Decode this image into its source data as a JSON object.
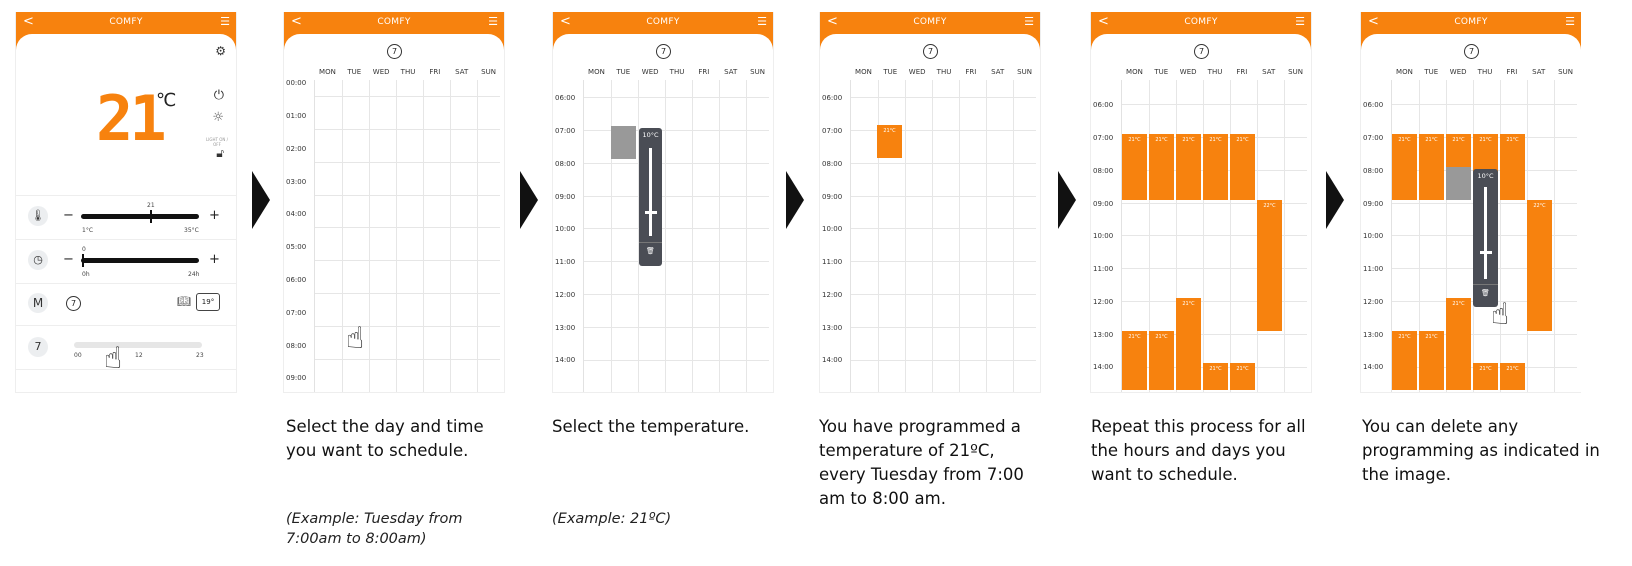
{
  "app": {
    "title": "COMFY",
    "back": "<",
    "menu": "☰",
    "mode_icon": "7"
  },
  "days": [
    "MON",
    "TUE",
    "WED",
    "THU",
    "FRI",
    "SAT",
    "SUN"
  ],
  "panel1": {
    "temperature": "21",
    "unit": "℃",
    "light_label": "LIGHT ON / OFF",
    "temp_slider": {
      "value": "21",
      "level": 0.59,
      "min": "1°C",
      "max": "35°C"
    },
    "timer_slider": {
      "value": "0",
      "level": 0.0,
      "min": "0h",
      "max": "24h"
    },
    "mode_letter": "M",
    "mode_badge": "7",
    "away_badge": "19°",
    "day_scale": {
      "start": "00",
      "mid": "12",
      "end": "23"
    }
  },
  "panel2": {
    "times": [
      "00:00",
      "01:00",
      "02:00",
      "03:00",
      "04:00",
      "05:00",
      "06:00",
      "07:00",
      "08:00",
      "09:00"
    ]
  },
  "panel3": {
    "times": [
      "06:00",
      "07:00",
      "08:00",
      "09:00",
      "10:00",
      "11:00",
      "12:00",
      "13:00",
      "14:00"
    ],
    "popup_value": "10°C"
  },
  "panel4": {
    "times": [
      "06:00",
      "07:00",
      "08:00",
      "09:00",
      "10:00",
      "11:00",
      "12:00",
      "13:00",
      "14:00"
    ],
    "block_label": "21°C"
  },
  "panel5": {
    "times": [
      "06:00",
      "07:00",
      "08:00",
      "09:00",
      "10:00",
      "11:00",
      "12:00",
      "13:00",
      "14:00"
    ],
    "label_21": "21°C",
    "label_22": "22°C"
  },
  "panel6": {
    "times": [
      "06:00",
      "07:00",
      "08:00",
      "09:00",
      "10:00",
      "11:00",
      "12:00",
      "13:00",
      "14:00"
    ],
    "label_21": "21°C",
    "label_22": "22°C",
    "popup_value": "10°C"
  },
  "captions": {
    "c2": "Select the day and time you want to schedule.",
    "c3": "Select the temperature.",
    "c4": "You have programmed a temperature of 21ºC, every Tuesday from 7:00 am to 8:00 am.",
    "c5": "Repeat this process for all the hours and days you want to schedule.",
    "c6": "You can delete any programming as indicated in the image.",
    "ex2": "(Example: Tuesday from 7:00am to 8:00am)",
    "ex3": "(Example: 21ºC)"
  }
}
